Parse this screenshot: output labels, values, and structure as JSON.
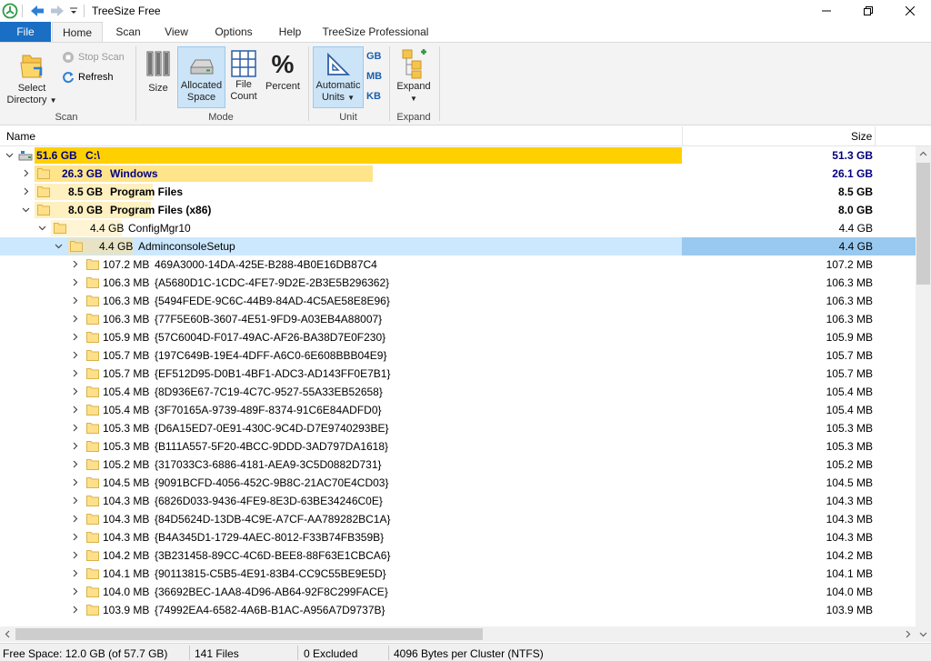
{
  "window": {
    "title": "TreeSize Free"
  },
  "ribbon_tabs": [
    "File",
    "Home",
    "Scan",
    "View",
    "Options",
    "Help",
    "TreeSize Professional"
  ],
  "ribbon": {
    "select_directory": {
      "line1": "Select",
      "line2": "Directory"
    },
    "stop_scan": "Stop Scan",
    "refresh": "Refresh",
    "scan_group": "Scan",
    "size": "Size",
    "allocated_space": {
      "line1": "Allocated",
      "line2": "Space"
    },
    "file_count": {
      "line1": "File",
      "line2": "Count"
    },
    "percent": "Percent",
    "mode_group": "Mode",
    "automatic_units": {
      "line1": "Automatic",
      "line2": "Units"
    },
    "gb": "GB",
    "mb": "MB",
    "kb": "KB",
    "unit_group": "Unit",
    "expand": "Expand",
    "expand_group": "Expand"
  },
  "columns": {
    "name": "Name",
    "size": "Size"
  },
  "tree": {
    "root": {
      "size": "51.6 GB",
      "name": "C:\\",
      "size_col": "51.3 GB",
      "fill": 1.0
    },
    "windows": {
      "size": "26.3 GB",
      "name": "Windows",
      "size_col": "26.1 GB",
      "fill": 0.51
    },
    "program_files": {
      "size": "8.5 GB",
      "name": "Program Files",
      "size_col": "8.5 GB",
      "fill": 0.165
    },
    "program_files_x86": {
      "size": "8.0 GB",
      "name": "Program Files (x86)",
      "size_col": "8.0 GB",
      "fill": 0.155
    },
    "configmgr": {
      "size": "4.4 GB",
      "name": "ConfigMgr10",
      "size_col": "4.4 GB"
    },
    "adminconsole": {
      "size": "4.4 GB",
      "name": "AdminconsoleSetup",
      "size_col": "4.4 GB"
    },
    "children": [
      {
        "size": "107.2 MB",
        "name": "469A3000-14DA-425E-B288-4B0E16DB87C4"
      },
      {
        "size": "106.3 MB",
        "name": "{A5680D1C-1CDC-4FE7-9D2E-2B3E5B296362}"
      },
      {
        "size": "106.3 MB",
        "name": "{5494FEDE-9C6C-44B9-84AD-4C5AE58E8E96}"
      },
      {
        "size": "106.3 MB",
        "name": "{77F5E60B-3607-4E51-9FD9-A03EB4A88007}"
      },
      {
        "size": "105.9 MB",
        "name": "{57C6004D-F017-49AC-AF26-BA38D7E0F230}"
      },
      {
        "size": "105.7 MB",
        "name": "{197C649B-19E4-4DFF-A6C0-6E608BBB04E9}"
      },
      {
        "size": "105.7 MB",
        "name": "{EF512D95-D0B1-4BF1-ADC3-AD143FF0E7B1}"
      },
      {
        "size": "105.4 MB",
        "name": "{8D936E67-7C19-4C7C-9527-55A33EB52658}"
      },
      {
        "size": "105.4 MB",
        "name": "{3F70165A-9739-489F-8374-91C6E84ADFD0}"
      },
      {
        "size": "105.3 MB",
        "name": "{D6A15ED7-0E91-430C-9C4D-D7E9740293BE}"
      },
      {
        "size": "105.3 MB",
        "name": "{B111A557-5F20-4BCC-9DDD-3AD797DA1618}"
      },
      {
        "size": "105.2 MB",
        "name": "{317033C3-6886-4181-AEA9-3C5D0882D731}"
      },
      {
        "size": "104.5 MB",
        "name": "{9091BCFD-4056-452C-9B8C-21AC70E4CD03}"
      },
      {
        "size": "104.3 MB",
        "name": "{6826D033-9436-4FE9-8E3D-63BE34246C0E}"
      },
      {
        "size": "104.3 MB",
        "name": "{84D5624D-13DB-4C9E-A7CF-AA789282BC1A}"
      },
      {
        "size": "104.3 MB",
        "name": "{B4A345D1-1729-4AEC-8012-F33B74FB359B}"
      },
      {
        "size": "104.2 MB",
        "name": "{3B231458-89CC-4C6D-BEE8-88F63E1CBCA6}"
      },
      {
        "size": "104.1 MB",
        "name": "{90113815-C5B5-4E91-83B4-CC9C55BE9E5D}"
      },
      {
        "size": "104.0 MB",
        "name": "{36692BEC-1AA8-4D96-AB64-92F8C299FACE}"
      },
      {
        "size": "103.9 MB",
        "name": "{74992EA4-6582-4A6B-B1AC-A956A7D9737B}"
      }
    ]
  },
  "status": {
    "free_space": "Free Space: 12.0 GB  (of 57.7 GB)",
    "files": "141  Files",
    "excluded": "0 Excluded",
    "cluster": "4096  Bytes per Cluster (NTFS)"
  },
  "colors": {
    "accent": "#1a6fc4",
    "bar_gold": "#ffcc00",
    "bar_light": "#ffeaa0",
    "selection": "#cce8ff"
  }
}
